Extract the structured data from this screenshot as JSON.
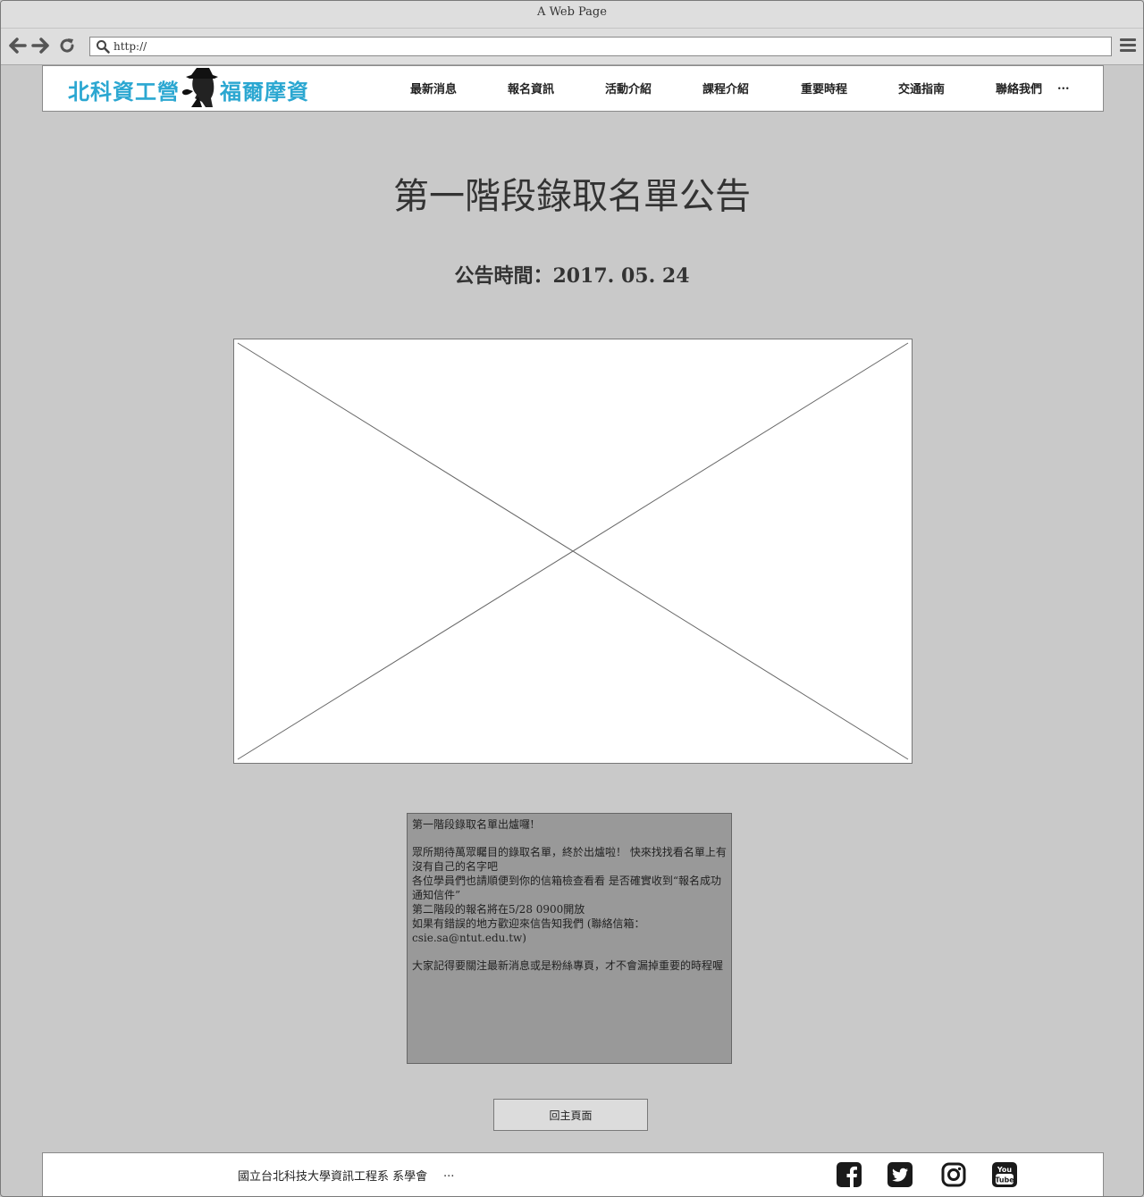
{
  "browser": {
    "window_title": "A Web Page",
    "url": "http://"
  },
  "site_header": {
    "logo_text_left": "北科資工營",
    "logo_text_right": "福爾摩資",
    "nav": [
      {
        "label": "最新消息"
      },
      {
        "label": "報名資訊"
      },
      {
        "label": "活動介紹"
      },
      {
        "label": "課程介紹"
      },
      {
        "label": "重要時程"
      },
      {
        "label": "交通指南"
      },
      {
        "label": "聯絡我們"
      },
      {
        "label": "..."
      }
    ]
  },
  "main": {
    "title": "第一階段錄取名單公告",
    "announce_time": "公告時間：2017. 05. 24",
    "notice": {
      "heading": "第一階段錄取名單出爐囉!",
      "line1": "眾所期待萬眾矚目的錄取名單，終於出爐啦！ 快來找找看名單上有沒有自己的名字吧",
      "line2": "各位學員們也請順便到你的信箱檢查看看 是否確實收到“報名成功通知信件”",
      "line3": "第二階段的報名將在5/28 0900開放",
      "line4": "如果有錯誤的地方歡迎來信告知我們 (聯絡信箱：csie.sa@ntut.edu.tw)",
      "line5": "大家記得要關注最新消息或是粉絲專頁，才不會漏掉重要的時程喔"
    },
    "home_button": "回主頁面"
  },
  "footer": {
    "text": "國立台北科技大學資訊工程系 系學會",
    "more": "...",
    "social": [
      "facebook-icon",
      "twitter-icon",
      "instagram-icon",
      "youtube-icon"
    ]
  },
  "colors": {
    "page_bg": "#c9c9c9",
    "logo_blue": "#2ba7d1",
    "notice_bg": "#999999"
  }
}
